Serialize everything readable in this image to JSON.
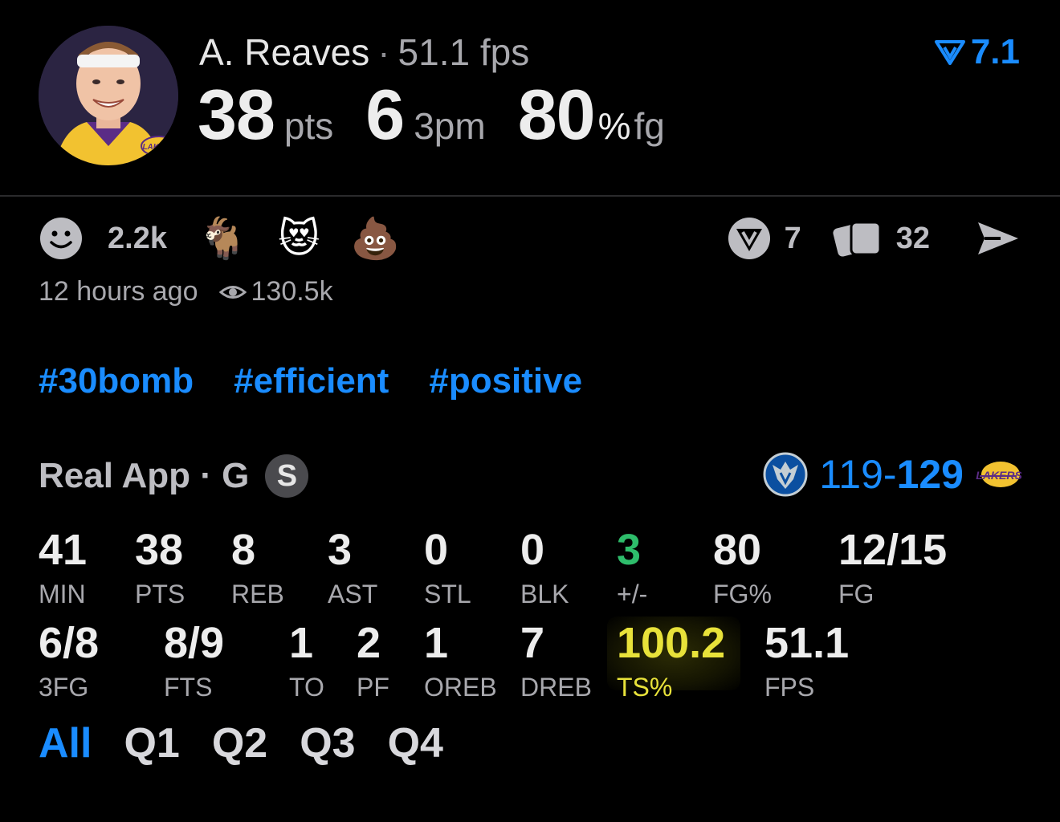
{
  "player": {
    "name": "A. Reaves",
    "separator": "·",
    "fps": "51.1 fps",
    "rating": "7.1"
  },
  "headline": {
    "pts_value": "38",
    "pts_unit": "pts",
    "threes_value": "6",
    "threes_unit": "3pm",
    "fg_value": "80",
    "fg_pct_sign": "%",
    "fg_unit": "fg"
  },
  "reactions": {
    "count": "2.2k",
    "emojis": [
      "🐐",
      "😻",
      "💩"
    ],
    "vote_count": "7",
    "card_count": "32"
  },
  "meta": {
    "posted": "12 hours ago",
    "views": "130.5k"
  },
  "tags": [
    "#30bomb",
    "#efficient",
    "#positive"
  ],
  "game": {
    "source": "Real App · G",
    "badge": "S",
    "score_left": "119",
    "score_dash": "-",
    "score_right": "129",
    "team_left": "mavericks-logo",
    "team_right": "lakers-logo"
  },
  "stats_row1": [
    {
      "value": "41",
      "label": "MIN"
    },
    {
      "value": "38",
      "label": "PTS"
    },
    {
      "value": "8",
      "label": "REB"
    },
    {
      "value": "3",
      "label": "AST"
    },
    {
      "value": "0",
      "label": "STL"
    },
    {
      "value": "0",
      "label": "BLK"
    },
    {
      "value": "3",
      "label": "+/-"
    },
    {
      "value": "80",
      "label": "FG%"
    },
    {
      "value": "12/15",
      "label": "FG"
    }
  ],
  "stats_row2": [
    {
      "value": "6/8",
      "label": "3FG"
    },
    {
      "value": "8/9",
      "label": "FTS"
    },
    {
      "value": "1",
      "label": "TO"
    },
    {
      "value": "2",
      "label": "PF"
    },
    {
      "value": "1",
      "label": "OREB"
    },
    {
      "value": "7",
      "label": "DREB"
    },
    {
      "value": "100.2",
      "label": "TS%"
    },
    {
      "value": "51.1",
      "label": "FPS"
    }
  ],
  "tabs": [
    "All",
    "Q1",
    "Q2",
    "Q3",
    "Q4"
  ],
  "colors": {
    "accent": "#1a8cff",
    "positive": "#2ebd6b",
    "highlight": "#e8e23a"
  }
}
